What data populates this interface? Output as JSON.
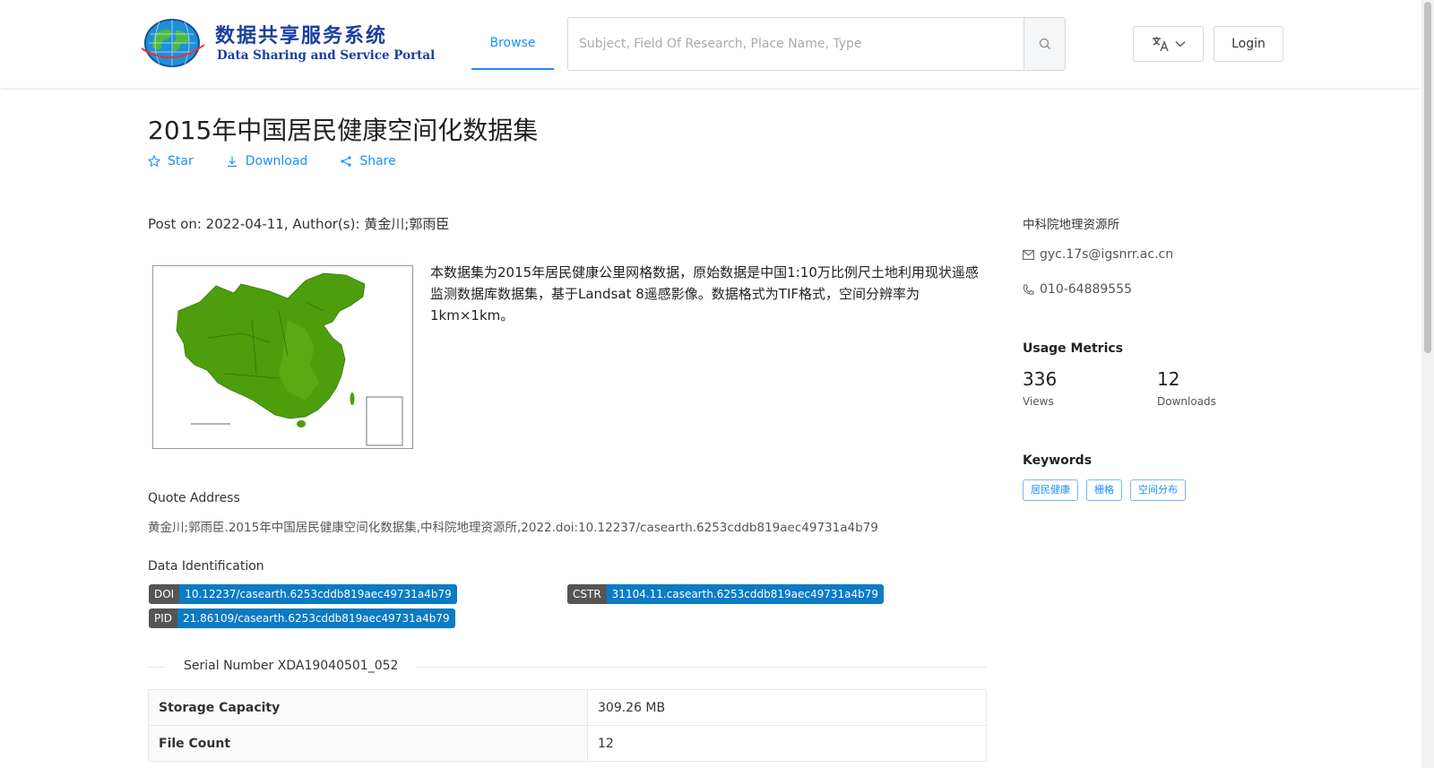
{
  "header": {
    "logo_cn": "数据共享服务系统",
    "logo_en": "Data Sharing and Service Portal",
    "nav_browse": "Browse",
    "search_placeholder": "Subject, Field Of Research, Place Name, Type",
    "login_label": "Login",
    "accent_color": "#1890ff"
  },
  "dataset": {
    "title": "2015年中国居民健康空间化数据集",
    "actions": {
      "star": "Star",
      "download": "Download",
      "share": "Share"
    },
    "post_on_label": "Post on:",
    "post_date": "2022-04-11",
    "authors_label": "Author(s):",
    "authors": "黄金川;郭雨臣",
    "description": "本数据集为2015年居民健康公里网格数据，原始数据是中国1:10万比例尺土地利用现状遥感监测数据库数据集，基于Landsat 8遥感影像。数据格式为TIF格式，空间分辨率为1km×1km。"
  },
  "quote": {
    "label": "Quote Address",
    "text": "黄金川;郭雨臣.2015年中国居民健康空间化数据集,中科院地理资源所,2022.doi:10.12237/casearth.6253cddb819aec49731a4b79"
  },
  "identification": {
    "label": "Data Identification",
    "doi_key": "DOI",
    "doi_value": "10.12237/casearth.6253cddb819aec49731a4b79",
    "cstr_key": "CSTR",
    "cstr_value": "31104.11.casearth.6253cddb819aec49731a4b79",
    "pid_key": "PID",
    "pid_value": "21.86109/casearth.6253cddb819aec49731a4b79"
  },
  "serial": {
    "text": "Serial Number XDA19040501_052"
  },
  "table": {
    "rows": [
      {
        "key": "Storage Capacity",
        "value": "309.26 MB"
      },
      {
        "key": "File Count",
        "value": "12"
      }
    ]
  },
  "sidebar": {
    "org": "中科院地理资源所",
    "email": "gyc.17s@igsnrr.ac.cn",
    "phone": "010-64889555",
    "usage_title": "Usage Metrics",
    "views_count": "336",
    "views_label": "Views",
    "downloads_count": "12",
    "downloads_label": "Downloads",
    "keywords_title": "Keywords",
    "keywords": [
      "居民健康",
      "栅格",
      "空间分布"
    ]
  }
}
